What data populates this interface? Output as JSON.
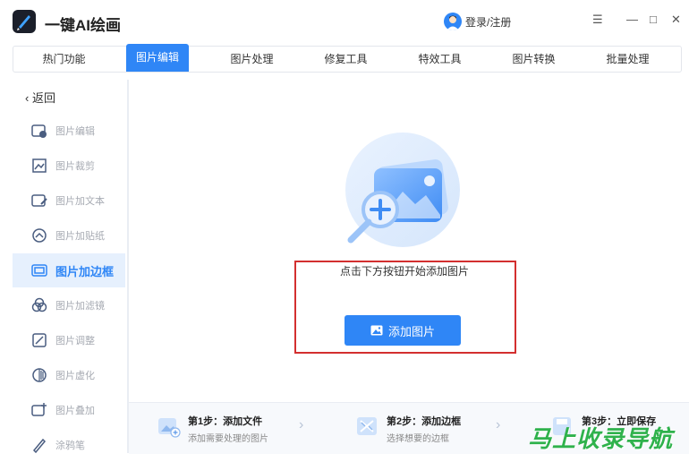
{
  "app": {
    "title": "一键AI绘画"
  },
  "header": {
    "login_label": "登录/注册",
    "menu_glyph": "☰",
    "minimize_glyph": "—",
    "maximize_glyph": "□",
    "close_glyph": "✕"
  },
  "tabs": [
    {
      "label": "热门功能"
    },
    {
      "label": "图片编辑"
    },
    {
      "label": "图片处理"
    },
    {
      "label": "修复工具"
    },
    {
      "label": "特效工具"
    },
    {
      "label": "图片转换"
    },
    {
      "label": "批量处理"
    }
  ],
  "active_tab": "图片编辑",
  "sidebar": {
    "back_label": "返回",
    "items": [
      {
        "label": "图片编辑",
        "icon": "image-edit-icon"
      },
      {
        "label": "图片裁剪",
        "icon": "crop-icon"
      },
      {
        "label": "图片加文本",
        "icon": "text-icon"
      },
      {
        "label": "图片加贴纸",
        "icon": "sticker-icon"
      },
      {
        "label": "图片加边框",
        "icon": "frame-icon"
      },
      {
        "label": "图片加滤镜",
        "icon": "filter-icon"
      },
      {
        "label": "图片调整",
        "icon": "adjust-icon"
      },
      {
        "label": "图片虚化",
        "icon": "blur-icon"
      },
      {
        "label": "图片叠加",
        "icon": "overlay-icon"
      },
      {
        "label": "涂鸦笔",
        "icon": "brush-icon"
      }
    ],
    "active_item": "图片加边框"
  },
  "main": {
    "prompt": "点击下方按钮开始添加图片",
    "add_button_label": "添加图片"
  },
  "steps": [
    {
      "title": "第1步：添加文件",
      "desc": "添加需要处理的图片"
    },
    {
      "title": "第2步：添加边框",
      "desc": "选择想要的边框"
    },
    {
      "title": "第3步：立即保存",
      "desc": ""
    }
  ],
  "watermark": "马上收录导航",
  "colors": {
    "accent": "#2f86f6",
    "highlight_box": "#d32f2f",
    "watermark": "#2fb24c"
  }
}
